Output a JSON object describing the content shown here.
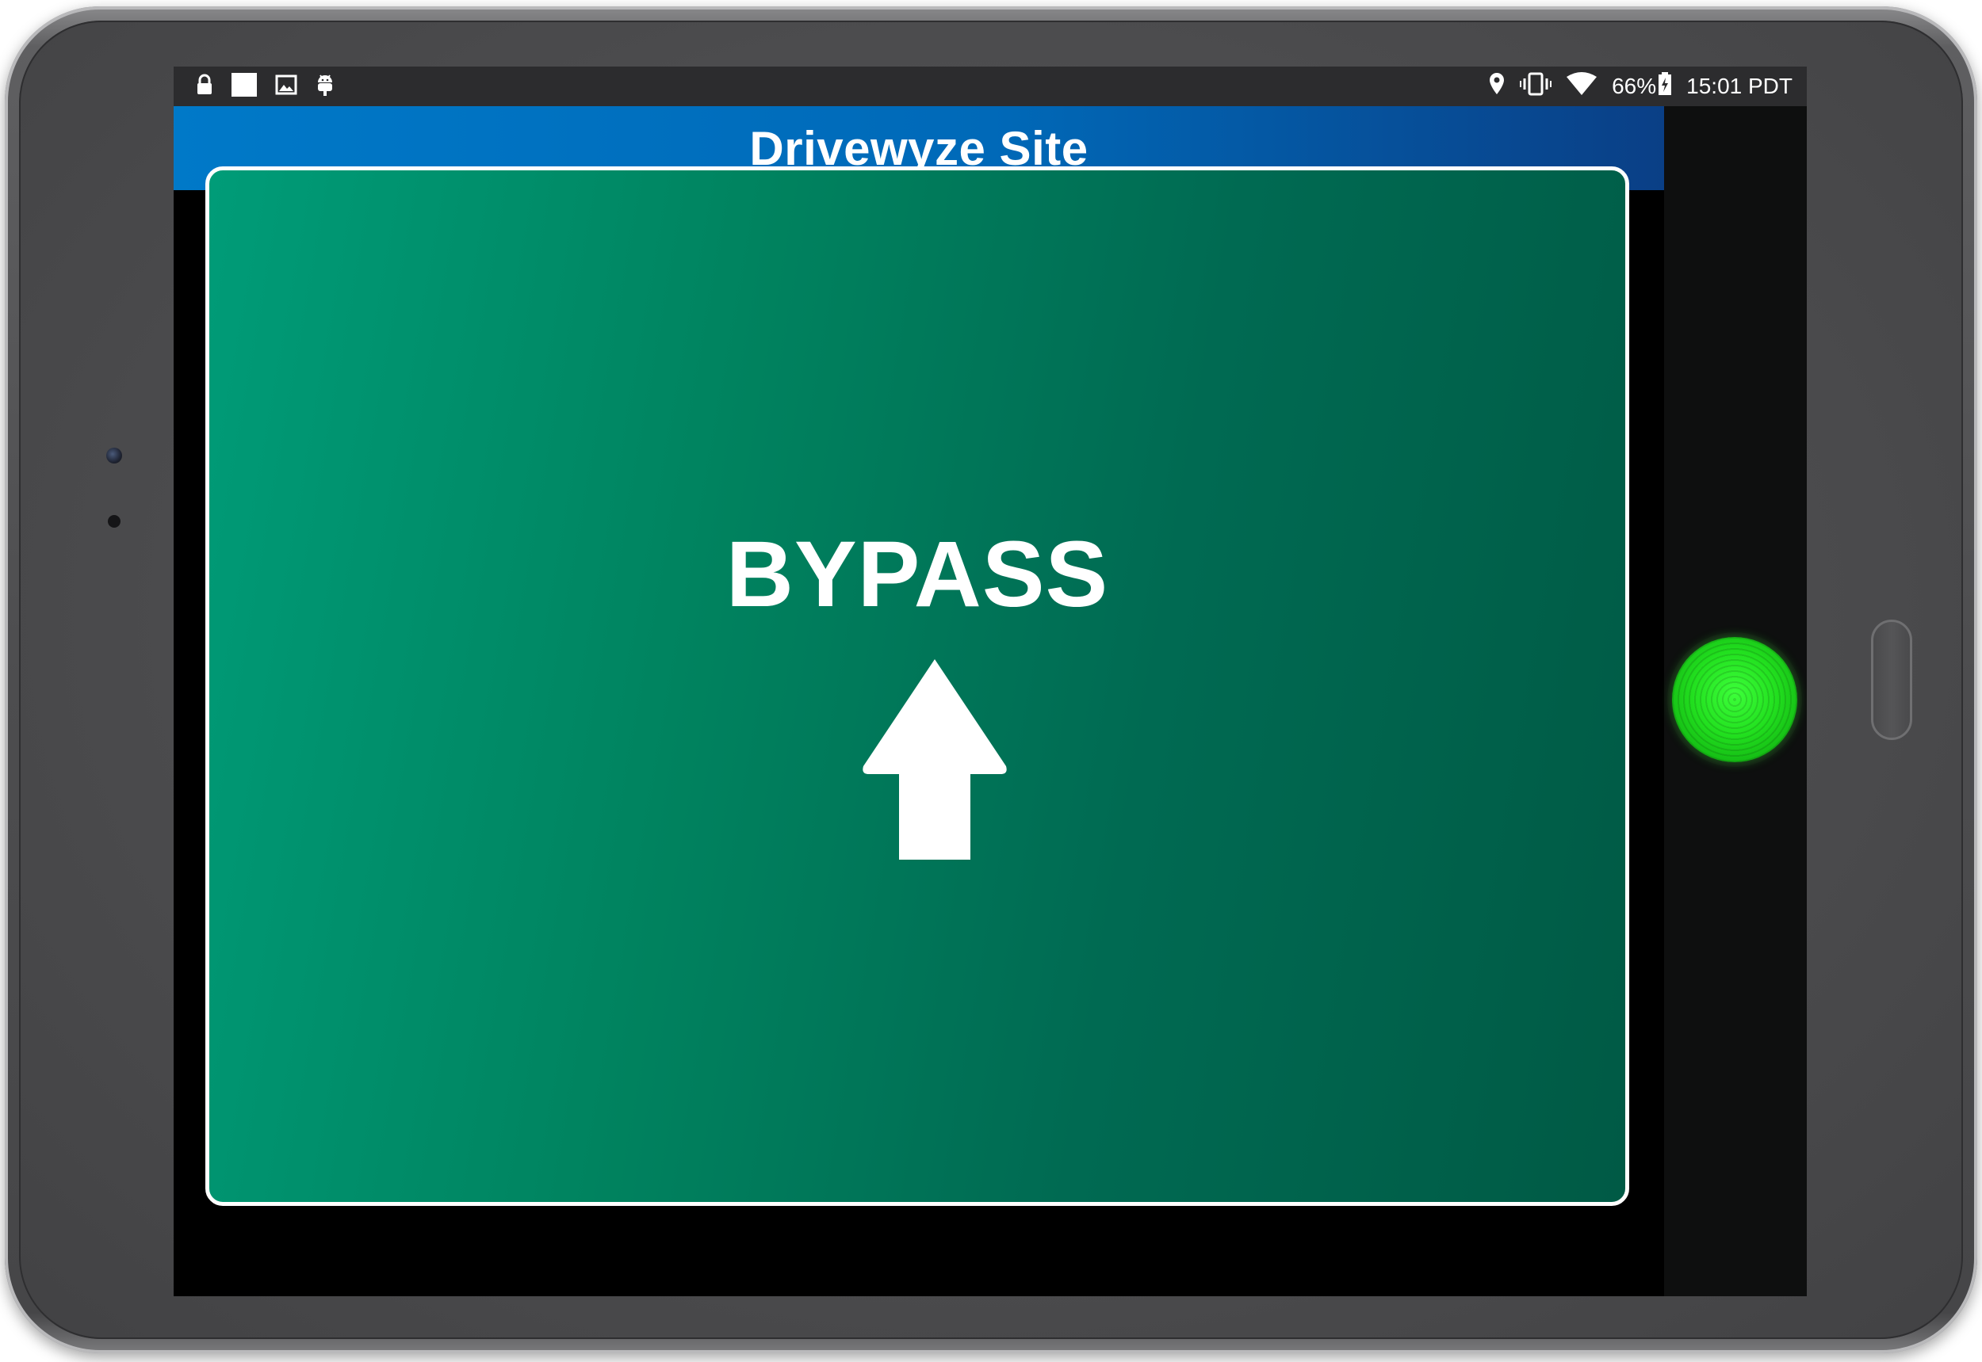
{
  "status_bar": {
    "battery": "66%",
    "clock": "15:01 PDT",
    "left_icons": [
      "lock-icon",
      "white-square-icon",
      "image-icon",
      "android-icon"
    ],
    "right_icons": [
      "location-icon",
      "vibrate-icon",
      "wifi-icon",
      "battery-charging-icon"
    ]
  },
  "app_bar": {
    "title": "Drivewyze Site"
  },
  "sign": {
    "label": "BYPASS",
    "arrow": "up-arrow-icon",
    "background_color": "#00835f"
  },
  "indicator": {
    "color": "#22e01f",
    "state": "green"
  },
  "colors": {
    "app_bar": "#0069b8",
    "status_bar": "#2c2c2e",
    "sign_border": "#ffffff"
  }
}
